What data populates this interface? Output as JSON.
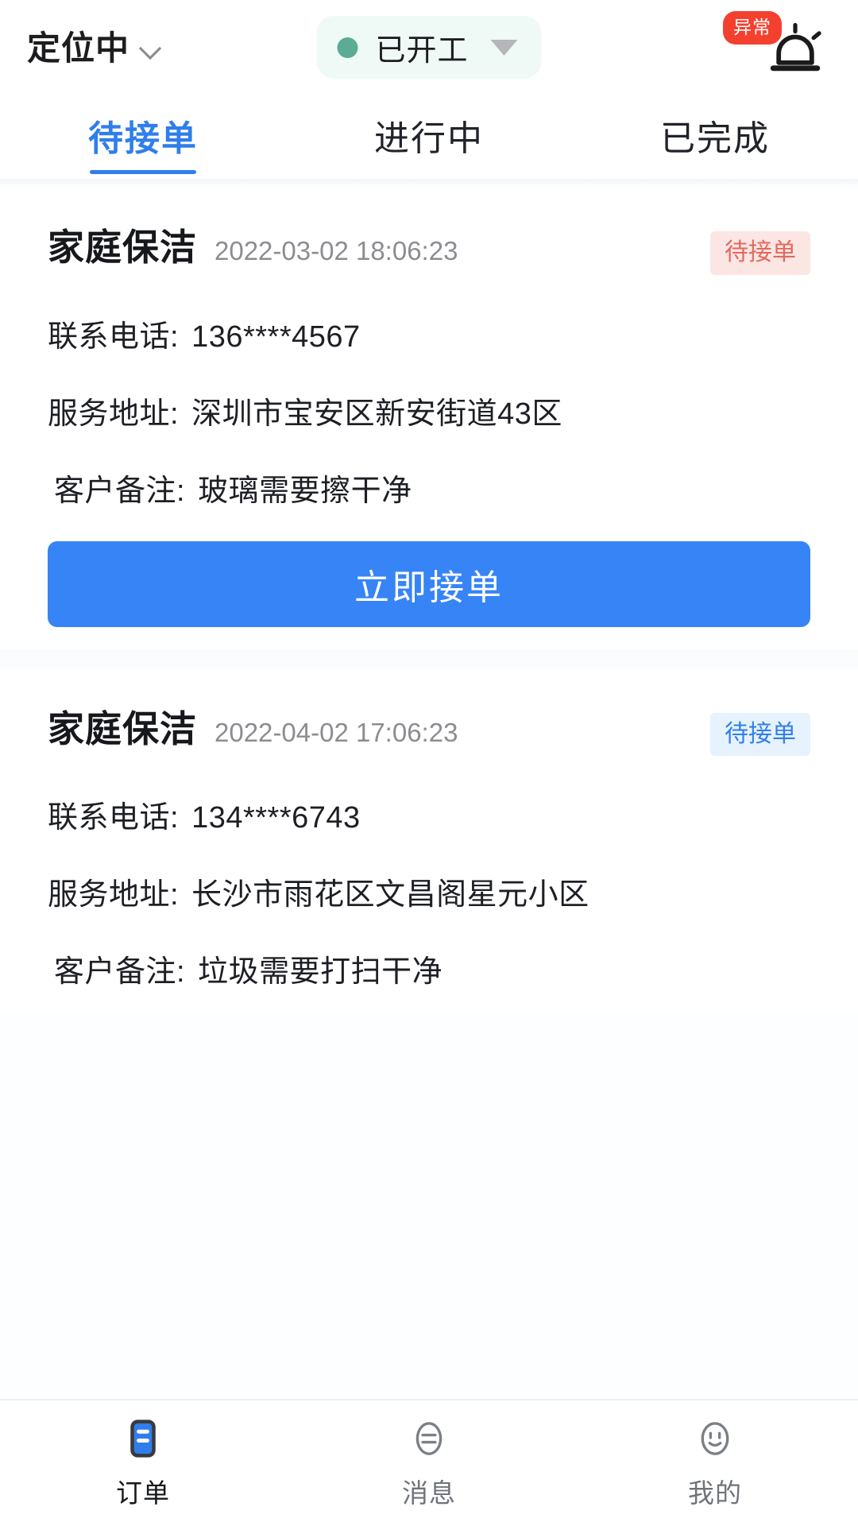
{
  "header": {
    "location_label": "定位中",
    "location_chevron_icon": "chevron-down-icon",
    "work_status": "已开工",
    "work_status_dot_color": "#5cab94",
    "work_status_bg": "#effaf7",
    "work_status_caret_icon": "caret-down-icon",
    "alarm_badge": "异常",
    "alarm_badge_color": "#f4402f",
    "alarm_icon": "alarm-siren-icon"
  },
  "tabs": [
    {
      "label": "待接单",
      "active": true
    },
    {
      "label": "进行中",
      "active": false
    },
    {
      "label": "已完成",
      "active": false
    }
  ],
  "labels": {
    "phone_label": "联系电话:",
    "address_label": "服务地址:",
    "remark_label": "客户备注:"
  },
  "accent_color": "#2f7eeb",
  "button_color": "#3784f7",
  "orders": [
    {
      "title": "家庭保洁",
      "time": "2022-03-02 18:06:23",
      "status": "待接单",
      "status_style": "pink",
      "phone": "136****4567",
      "address": "深圳市宝安区新安街道43区",
      "remark": "玻璃需要擦干净",
      "action_label": "立即接单"
    },
    {
      "title": "家庭保洁",
      "time": "2022-04-02 17:06:23",
      "status": "待接单",
      "status_style": "blue",
      "phone": "134****6743",
      "address": "长沙市雨花区文昌阁星元小区",
      "remark": "垃圾需要打扫干净"
    }
  ],
  "bottom_nav": [
    {
      "label": "订单",
      "icon": "document-icon",
      "active": true
    },
    {
      "label": "消息",
      "icon": "message-oval-icon",
      "active": false
    },
    {
      "label": "我的",
      "icon": "smiley-face-icon",
      "active": false
    }
  ]
}
